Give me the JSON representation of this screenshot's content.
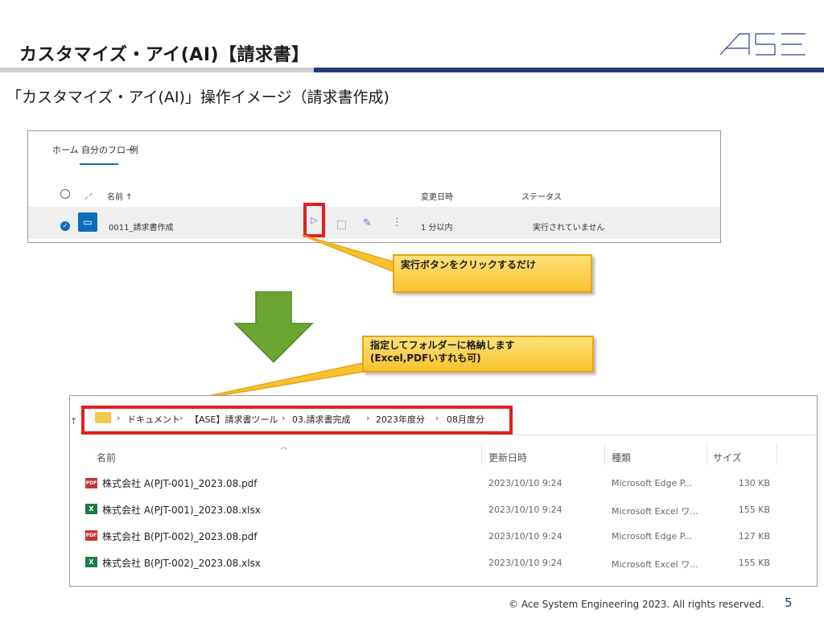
{
  "slide": {
    "title": "カスタマイズ・アイ(AI)【請求書】",
    "subtitle": "「カスタマイズ・アイ(AI)」操作イメージ（請求書作成)",
    "copyright": "© Ace System Engineering 2023. All rights reserved.",
    "page_number": "5",
    "logo_text": "ASE"
  },
  "flow_panel": {
    "tabs": [
      "ホーム",
      "自分のフロー",
      "例"
    ],
    "active_tab": "自分のフロー",
    "columns": {
      "name": "名前 ↑",
      "modified": "変更日時",
      "status": "ステータス"
    },
    "row": {
      "name": "0011_請求書作成",
      "modified": "1 分以内",
      "status": "実行されていません"
    }
  },
  "callouts": {
    "run": "実行ボタンをクリックするだけ",
    "store_line1": "指定してフォルダーに格納します",
    "store_line2": "(Excel,PDFいすれも可)"
  },
  "explorer": {
    "breadcrumb": [
      "ドキュメント",
      "【ASE】請求書ツール",
      "03.請求書完成",
      "2023年度分",
      "08月度分"
    ],
    "columns": {
      "name": "名前",
      "date": "更新日時",
      "type": "種類",
      "size": "サイズ"
    },
    "files": [
      {
        "icon": "pdf-icon",
        "name": "株式会社 A(PJT-001)_2023.08.pdf",
        "date": "2023/10/10 9:24",
        "type": "Microsoft Edge P...",
        "size": "130 KB"
      },
      {
        "icon": "excel-icon",
        "name": "株式会社 A(PJT-001)_2023.08.xlsx",
        "date": "2023/10/10 9:24",
        "type": "Microsoft Excel ワ...",
        "size": "155 KB"
      },
      {
        "icon": "pdf-icon",
        "name": "株式会社 B(PJT-002)_2023.08.pdf",
        "date": "2023/10/10 9:24",
        "type": "Microsoft Edge P...",
        "size": "127 KB"
      },
      {
        "icon": "excel-icon",
        "name": "株式会社 B(PJT-002)_2023.08.xlsx",
        "date": "2023/10/10 9:24",
        "type": "Microsoft Excel ワ...",
        "size": "155 KB"
      }
    ]
  },
  "colors": {
    "accent_blue": "#1f3d7a",
    "highlight_red": "#e02020",
    "callout_yellow": "#f7c22e",
    "arrow_green": "#6aa532"
  },
  "icons": [
    "folder-icon",
    "pdf-icon",
    "excel-icon",
    "play-icon",
    "edit-icon",
    "more-icon",
    "flow-icon",
    "down-arrow"
  ]
}
